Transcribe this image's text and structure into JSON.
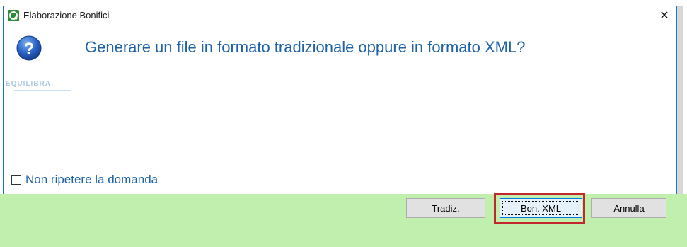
{
  "window": {
    "title": "Elaborazione Bonifici",
    "close_glyph": "✕"
  },
  "dialog": {
    "icon": "question-icon",
    "message": "Generare un file in formato tradizionale oppure in formato XML?",
    "watermark_text": "EQUILIBRA"
  },
  "options": {
    "dont_repeat_label": "Non ripetere la domanda",
    "dont_repeat_checked": false
  },
  "buttons": {
    "tradiz_label": "Tradiz.",
    "xml_label": "Bon. XML",
    "annulla_label": "Annulla"
  },
  "colors": {
    "accent_text": "#1e63a8",
    "button_bar": "#c0efae",
    "highlight": "#c4262e",
    "window_border": "#1779c6"
  }
}
